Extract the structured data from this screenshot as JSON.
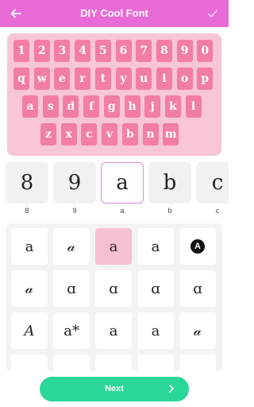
{
  "header": {
    "title": "DIY Cool Font",
    "back_icon": "arrow-left-icon",
    "confirm_icon": "check-icon",
    "background": "#e86ad6"
  },
  "keyboard_preview": {
    "background": "#f8c6d4",
    "key_color": "#f27ea1",
    "rows": [
      [
        "1",
        "2",
        "3",
        "4",
        "5",
        "6",
        "7",
        "8",
        "9",
        "0"
      ],
      [
        "q",
        "w",
        "e",
        "r",
        "t",
        "y",
        "u",
        "i",
        "o",
        "p"
      ],
      [
        "a",
        "s",
        "d",
        "f",
        "g",
        "h",
        "j",
        "k",
        "l"
      ],
      [
        "z",
        "x",
        "c",
        "v",
        "b",
        "n",
        "m"
      ]
    ]
  },
  "font_strip": {
    "items": [
      {
        "glyph": "8",
        "caption": "8",
        "selected": false
      },
      {
        "glyph": "9",
        "caption": "9",
        "selected": false
      },
      {
        "glyph": "a",
        "caption": "a",
        "selected": true
      },
      {
        "glyph": "b",
        "caption": "b",
        "selected": false
      },
      {
        "glyph": "c",
        "caption": "c",
        "selected": false
      }
    ],
    "selected_border": "#d98ad8"
  },
  "style_grid": {
    "selected_color": "#f7bfd2",
    "cells": [
      {
        "glyph": "a"
      },
      {
        "glyph": "𝒶"
      },
      {
        "glyph": "a",
        "selected": true
      },
      {
        "glyph": "a"
      },
      {
        "glyph": "A",
        "circled": true
      },
      {
        "glyph": "𝒶"
      },
      {
        "glyph": "ɑ"
      },
      {
        "glyph": "ɑ"
      },
      {
        "glyph": "ɑ"
      },
      {
        "glyph": "ɑ"
      },
      {
        "glyph": "𝐴"
      },
      {
        "glyph": "a*"
      },
      {
        "glyph": "a"
      },
      {
        "glyph": "a"
      },
      {
        "glyph": "𝒶"
      },
      {
        "glyph": ""
      },
      {
        "glyph": ""
      },
      {
        "glyph": ""
      },
      {
        "glyph": ""
      },
      {
        "glyph": ""
      }
    ]
  },
  "next_button": {
    "label": "Next",
    "icon": "chevron-right-icon",
    "color": "#29d796"
  }
}
